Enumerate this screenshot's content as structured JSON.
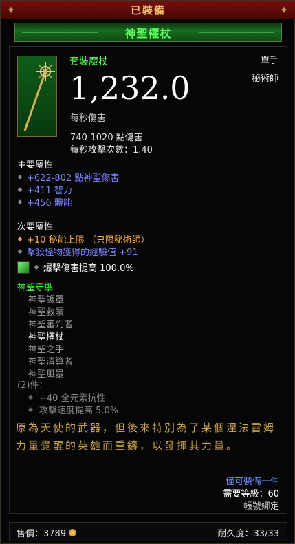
{
  "header": {
    "status": "已裝備"
  },
  "item": {
    "name": "神聖權杖",
    "type": "套裝魔杖",
    "hand": "單手",
    "class": "秘術師",
    "dps": "1,232.0",
    "dps_label": "每秒傷害",
    "damage": "740-1020 點傷害",
    "attack_speed": "每秒攻擊次數：1.40",
    "icon": "holy-scepter-icon"
  },
  "primary": {
    "title": "主要屬性",
    "stats": [
      "+622-802 點神聖傷害",
      "+411 智力",
      "+456 體能"
    ]
  },
  "secondary": {
    "title": "次要屬性",
    "stats": [
      "+10 秘能上限 （只限秘術師）",
      "擊殺怪物獲得的經驗值 +91"
    ]
  },
  "socket": {
    "text": "爆擊傷害提高 100.0%",
    "icon": "emerald-gem-icon"
  },
  "set": {
    "title": "神聖守禦",
    "pieces": [
      "神聖護罩",
      "神聖救贖",
      "神聖審判者",
      "神聖權杖",
      "神聖之手",
      "神聖清算者",
      "神聖風暴"
    ],
    "active_piece": "神聖權杖",
    "count": "(2)件：",
    "bonuses": [
      "+40 全元素抗性",
      "攻擊速度提高 5.0%"
    ]
  },
  "flavor": "原為天使的武器，但後來特別為了某個涅法雷姆力量覺醒的英雄而重鑄，以發揮其力量。",
  "requirements": {
    "equip_only": "僅可裝備一件",
    "level": "需要等級：60",
    "bound": "帳號綁定"
  },
  "footer": {
    "sell_price": "售價：3789",
    "durability": "耐久度：33/33"
  },
  "colors": {
    "set_green": "#5cff5c",
    "magic_blue": "#7f86ff",
    "legend_orange": "#ffae3b",
    "flavor_gold": "#c7a24b",
    "header_red": "#7a0d0d"
  }
}
